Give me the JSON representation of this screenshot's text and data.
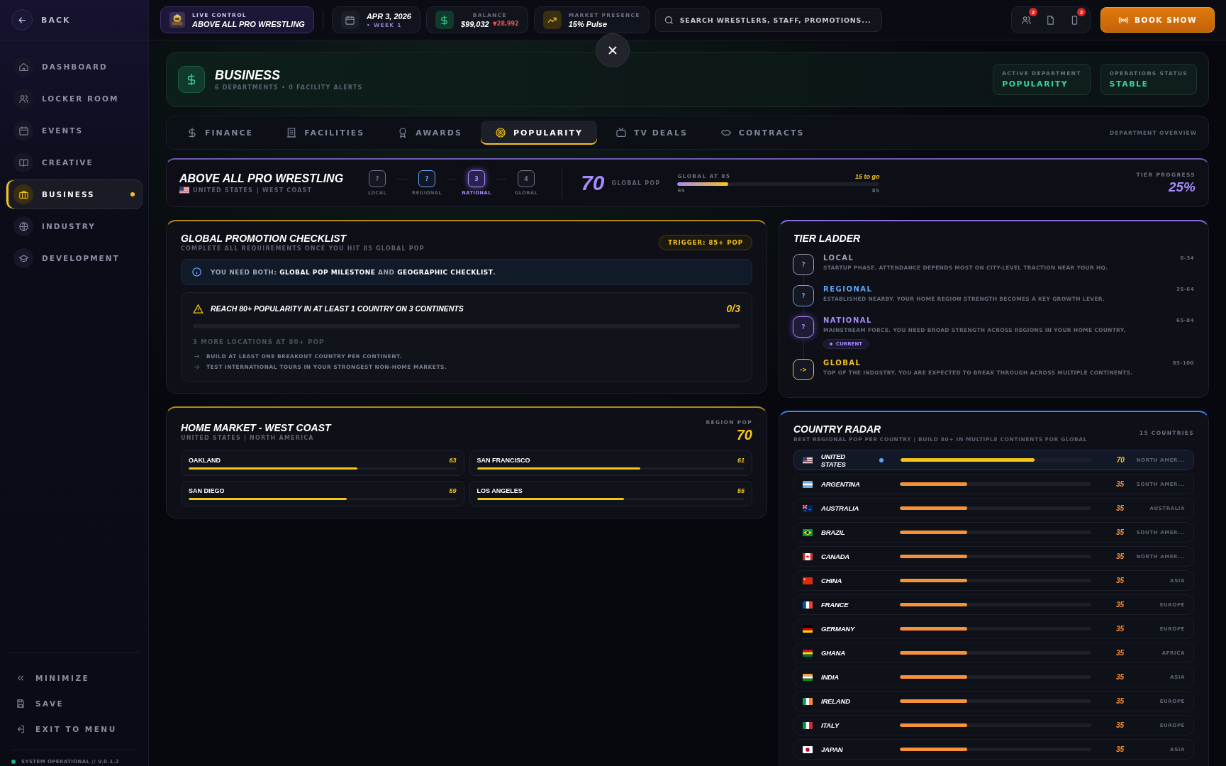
{
  "sidebar": {
    "back": "BACK",
    "items": [
      {
        "label": "DASHBOARD",
        "selected": false
      },
      {
        "label": "LOCKER ROOM",
        "selected": false
      },
      {
        "label": "EVENTS",
        "selected": false
      },
      {
        "label": "CREATIVE",
        "selected": false
      },
      {
        "label": "BUSINESS",
        "selected": true
      },
      {
        "label": "INDUSTRY",
        "selected": false
      },
      {
        "label": "DEVELOPMENT",
        "selected": false
      }
    ],
    "footer": [
      "MINIMIZE",
      "SAVE",
      "EXIT TO MENU"
    ],
    "status": "SYSTEM OPERATIONAL // V.0.1.2"
  },
  "topbar": {
    "live_label": "LIVE CONTROL",
    "live_name": "ABOVE ALL PRO WRESTLING",
    "date": "APR 3, 2026",
    "week": "• WEEK 1",
    "balance_label": "BALANCE",
    "balance": "$99,032",
    "balance_change": "▼28,992",
    "presence_label": "MARKET PRESENCE",
    "presence": "15% Pulse",
    "search": {
      "placeholder": "SEARCH WRESTLERS, STAFF, PROMOTIONS..."
    },
    "badges": [
      "2",
      "2"
    ],
    "book": "BOOK SHOW"
  },
  "header": {
    "title": "BUSINESS",
    "subtitle": "6 DEPARTMENTS • 0 FACILITY ALERTS",
    "active_label": "ACTIVE DEPARTMENT",
    "active_value": "POPULARITY",
    "status_label": "OPERATIONS STATUS",
    "status_value": "STABLE"
  },
  "tabs": [
    {
      "label": "FINANCE",
      "selected": false
    },
    {
      "label": "FACILITIES",
      "selected": false
    },
    {
      "label": "AWARDS",
      "selected": false
    },
    {
      "label": "POPULARITY",
      "selected": true
    },
    {
      "label": "TV DEALS",
      "selected": false
    },
    {
      "label": "CONTRACTS",
      "selected": false
    }
  ],
  "tabs_note": "DEPARTMENT OVERVIEW",
  "summary": {
    "name": "ABOVE ALL PRO WRESTLING",
    "location": "UNITED STATES",
    "region": "| WEST COAST",
    "steps": [
      {
        "mark": "?",
        "label": "LOCAL",
        "color": "#6b7280",
        "selected": false
      },
      {
        "mark": "?",
        "label": "REGIONAL",
        "color": "#60a5fa",
        "selected": false
      },
      {
        "mark": "3",
        "label": "NATIONAL",
        "color": "#a78bfa",
        "selected": true
      },
      {
        "mark": "4",
        "label": "GLOBAL",
        "color": "#6b7280",
        "selected": false
      }
    ],
    "pop": "70",
    "pop_label": "GLOBAL POP",
    "goal_label": "GLOBAL AT 85",
    "to_go": "15 to go",
    "level": 0.25,
    "min": "65",
    "max": "85",
    "progress_label": "TIER PROGRESS",
    "progress": "25%"
  },
  "checklist": {
    "title": "GLOBAL PROMOTION CHECKLIST",
    "subtitle": "COMPLETE ALL REQUIREMENTS ONCE YOU HIT 85 GLOBAL POP",
    "trigger": "TRIGGER: 85+ POP",
    "info": "YOU NEED BOTH: **GLOBAL POP MILESTONE** AND **GEOGRAPHIC CHECKLIST**.",
    "requirement": "REACH 80+ POPULARITY IN AT LEAST 1 COUNTRY ON 3 CONTINENTS",
    "count": "0/3",
    "level": 0,
    "remaining": "3 MORE LOCATIONS AT 80+ POP",
    "tips": [
      "BUILD AT LEAST ONE BREAKOUT COUNTRY PER CONTINENT.",
      "TEST INTERNATIONAL TOURS IN YOUR STRONGEST NON-HOME MARKETS."
    ]
  },
  "home_market": {
    "title": "HOME MARKET - WEST COAST",
    "subtitle": "UNITED STATES | NORTH AMERICA",
    "pop_label": "REGION POP",
    "pop": "70",
    "cities": [
      {
        "name": "OAKLAND",
        "value": "63",
        "level": 0.63
      },
      {
        "name": "SAN FRANCISCO",
        "value": "61",
        "level": 0.61
      },
      {
        "name": "SAN DIEGO",
        "value": "59",
        "level": 0.59
      },
      {
        "name": "LOS ANGELES",
        "value": "55",
        "level": 0.55
      }
    ]
  },
  "tier_ladder": {
    "title": "TIER LADDER",
    "current_badge": "CURRENT",
    "tiers": [
      {
        "mark": "?",
        "name": "LOCAL",
        "range": "0-34",
        "text": "STARTUP PHASE. ATTENDANCE DEPENDS MOST ON CITY-LEVEL TRACTION NEAR YOUR HQ.",
        "color": "#9ca3af",
        "current": false
      },
      {
        "mark": "?",
        "name": "REGIONAL",
        "range": "35-64",
        "text": "ESTABLISHED NEARBY. YOUR HOME REGION STRENGTH BECOMES A KEY GROWTH LEVER.",
        "color": "#60a5fa",
        "current": false
      },
      {
        "mark": "?",
        "name": "NATIONAL",
        "range": "65-84",
        "text": "MAINSTREAM FORCE. YOU NEED BROAD STRENGTH ACROSS REGIONS IN YOUR HOME COUNTRY.",
        "color": "#a78bfa",
        "current": true
      },
      {
        "mark": "->",
        "name": "GLOBAL",
        "range": "85-100",
        "text": "TOP OF THE INDUSTRY. YOU ARE EXPECTED TO BREAK THROUGH ACROSS MULTIPLE CONTINENTS.",
        "color": "#f5c518",
        "current": false
      }
    ]
  },
  "country_radar": {
    "title": "COUNTRY RADAR",
    "subtitle": "BEST REGIONAL POP PER COUNTRY | BUILD 80+ IN MULTIPLE CONTINENTS FOR GLOBAL",
    "count": "15 COUNTRIES",
    "countries": [
      {
        "name": "UNITED STATES",
        "value": "70",
        "level": 0.7,
        "continent": "NORTH AMER...",
        "home": true
      },
      {
        "name": "ARGENTINA",
        "value": "35",
        "level": 0.35,
        "continent": "SOUTH AMER...",
        "home": false
      },
      {
        "name": "AUSTRALIA",
        "value": "35",
        "level": 0.35,
        "continent": "AUSTRALIA",
        "home": false
      },
      {
        "name": "BRAZIL",
        "value": "35",
        "level": 0.35,
        "continent": "SOUTH AMER...",
        "home": false
      },
      {
        "name": "CANADA",
        "value": "35",
        "level": 0.35,
        "continent": "NORTH AMER...",
        "home": false
      },
      {
        "name": "CHINA",
        "value": "35",
        "level": 0.35,
        "continent": "ASIA",
        "home": false
      },
      {
        "name": "FRANCE",
        "value": "35",
        "level": 0.35,
        "continent": "EUROPE",
        "home": false
      },
      {
        "name": "GERMANY",
        "value": "35",
        "level": 0.35,
        "continent": "EUROPE",
        "home": false
      },
      {
        "name": "GHANA",
        "value": "35",
        "level": 0.35,
        "continent": "AFRICA",
        "home": false
      },
      {
        "name": "INDIA",
        "value": "35",
        "level": 0.35,
        "continent": "ASIA",
        "home": false
      },
      {
        "name": "IRELAND",
        "value": "35",
        "level": 0.35,
        "continent": "EUROPE",
        "home": false
      },
      {
        "name": "ITALY",
        "value": "35",
        "level": 0.35,
        "continent": "EUROPE",
        "home": false
      },
      {
        "name": "JAPAN",
        "value": "35",
        "level": 0.35,
        "continent": "ASIA",
        "home": false
      }
    ]
  }
}
